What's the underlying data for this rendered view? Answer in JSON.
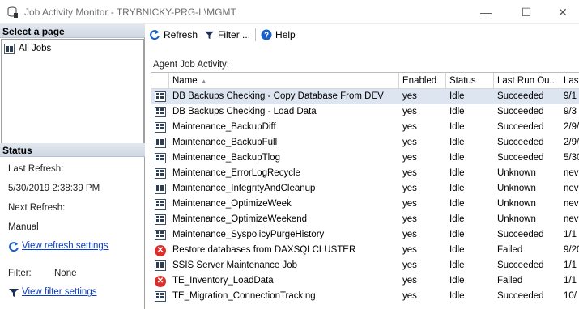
{
  "window": {
    "title": "Job Activity Monitor - TRYBNICKY-PRG-L\\MGMT",
    "minimize": "—",
    "maximize": "☐",
    "close": "✕"
  },
  "left": {
    "select_page_header": "Select a page",
    "pages": [
      {
        "label": "All Jobs"
      }
    ],
    "status_header": "Status",
    "last_refresh_label": "Last Refresh:",
    "last_refresh_value": "5/30/2019 2:38:39 PM",
    "next_refresh_label": "Next Refresh:",
    "next_refresh_value": "Manual",
    "view_refresh_settings": "View refresh settings",
    "filter_label": "Filter:",
    "filter_value": "None",
    "view_filter_settings": "View filter settings"
  },
  "toolbar": {
    "refresh": "Refresh",
    "filter": "Filter ...",
    "help": "Help"
  },
  "grid": {
    "caption": "Agent Job Activity:",
    "columns": [
      "",
      "Name",
      "Enabled",
      "Status",
      "Last Run Ou...",
      "Last"
    ],
    "rows": [
      {
        "icon": "job",
        "name": "DB Backups Checking - Copy Database From DEV",
        "enabled": "yes",
        "status": "Idle",
        "last_run": "Succeeded",
        "last": "9/1",
        "selected": true
      },
      {
        "icon": "job",
        "name": "DB Backups Checking - Load Data",
        "enabled": "yes",
        "status": "Idle",
        "last_run": "Succeeded",
        "last": "9/3"
      },
      {
        "icon": "job",
        "name": "Maintenance_BackupDiff",
        "enabled": "yes",
        "status": "Idle",
        "last_run": "Succeeded",
        "last": "2/9/"
      },
      {
        "icon": "job",
        "name": "Maintenance_BackupFull",
        "enabled": "yes",
        "status": "Idle",
        "last_run": "Succeeded",
        "last": "2/9/"
      },
      {
        "icon": "job",
        "name": "Maintenance_BackupTlog",
        "enabled": "yes",
        "status": "Idle",
        "last_run": "Succeeded",
        "last": "5/30"
      },
      {
        "icon": "job",
        "name": "Maintenance_ErrorLogRecycle",
        "enabled": "yes",
        "status": "Idle",
        "last_run": "Unknown",
        "last": "nev"
      },
      {
        "icon": "job",
        "name": "Maintenance_IntegrityAndCleanup",
        "enabled": "yes",
        "status": "Idle",
        "last_run": "Unknown",
        "last": "nev"
      },
      {
        "icon": "job",
        "name": "Maintenance_OptimizeWeek",
        "enabled": "yes",
        "status": "Idle",
        "last_run": "Unknown",
        "last": "nev"
      },
      {
        "icon": "job",
        "name": "Maintenance_OptimizeWeekend",
        "enabled": "yes",
        "status": "Idle",
        "last_run": "Unknown",
        "last": "nev"
      },
      {
        "icon": "job",
        "name": "Maintenance_SyspolicyPurgeHistory",
        "enabled": "yes",
        "status": "Idle",
        "last_run": "Succeeded",
        "last": "1/1"
      },
      {
        "icon": "fail",
        "name": "Restore databases from DAXSQLCLUSTER",
        "enabled": "yes",
        "status": "Idle",
        "last_run": "Failed",
        "last": "9/20"
      },
      {
        "icon": "job",
        "name": "SSIS Server Maintenance Job",
        "enabled": "yes",
        "status": "Idle",
        "last_run": "Succeeded",
        "last": "1/1"
      },
      {
        "icon": "fail",
        "name": "TE_Inventory_LoadData",
        "enabled": "yes",
        "status": "Idle",
        "last_run": "Failed",
        "last": "1/1"
      },
      {
        "icon": "job",
        "name": "TE_Migration_ConnectionTracking",
        "enabled": "yes",
        "status": "Idle",
        "last_run": "Succeeded",
        "last": "10/"
      }
    ]
  },
  "colors": {
    "selected_row": "#dde5f0",
    "link": "#0a3cc8",
    "fail": "#d9302c"
  }
}
